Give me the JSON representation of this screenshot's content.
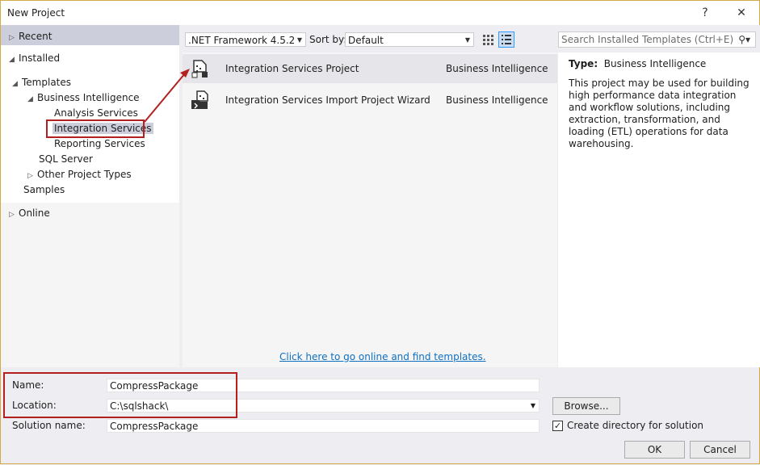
{
  "window": {
    "title": "New Project",
    "help": "?",
    "close": "✕"
  },
  "tree": {
    "recent": "Recent",
    "installed": "Installed",
    "templates": "Templates",
    "business_intelligence": "Business Intelligence",
    "analysis_services": "Analysis Services",
    "integration_services": "Integration Services",
    "reporting_services": "Reporting Services",
    "sql_server": "SQL Server",
    "other_project_types": "Other Project Types",
    "samples": "Samples",
    "online": "Online"
  },
  "toolbar": {
    "framework": ".NET Framework 4.5.2",
    "sort_label": "Sort by:",
    "sort_value": "Default",
    "search_placeholder": "Search Installed Templates (Ctrl+E)"
  },
  "templates": [
    {
      "name": "Integration Services Project",
      "category": "Business Intelligence",
      "icon": "ssis-project-icon"
    },
    {
      "name": "Integration Services Import Project Wizard",
      "category": "Business Intelligence",
      "icon": "import-wizard-icon"
    }
  ],
  "online_link": "Click here to go online and find templates.",
  "description": {
    "type_label": "Type:",
    "type_value": "Business Intelligence",
    "text": "This project may be used for building high performance data integration and workflow solutions, including extraction, transformation, and loading (ETL) operations for data warehousing."
  },
  "form": {
    "name_label": "Name:",
    "name_value": "CompressPackage",
    "location_label": "Location:",
    "location_value": "C:\\sqlshack\\",
    "solution_label": "Solution name:",
    "solution_value": "CompressPackage",
    "browse": "Browse...",
    "create_dir": "Create directory for solution",
    "create_dir_checked": true,
    "ok": "OK",
    "cancel": "Cancel"
  },
  "colors": {
    "highlight": "#b32020",
    "link": "#0e70c0",
    "selection": "#cccedb"
  }
}
